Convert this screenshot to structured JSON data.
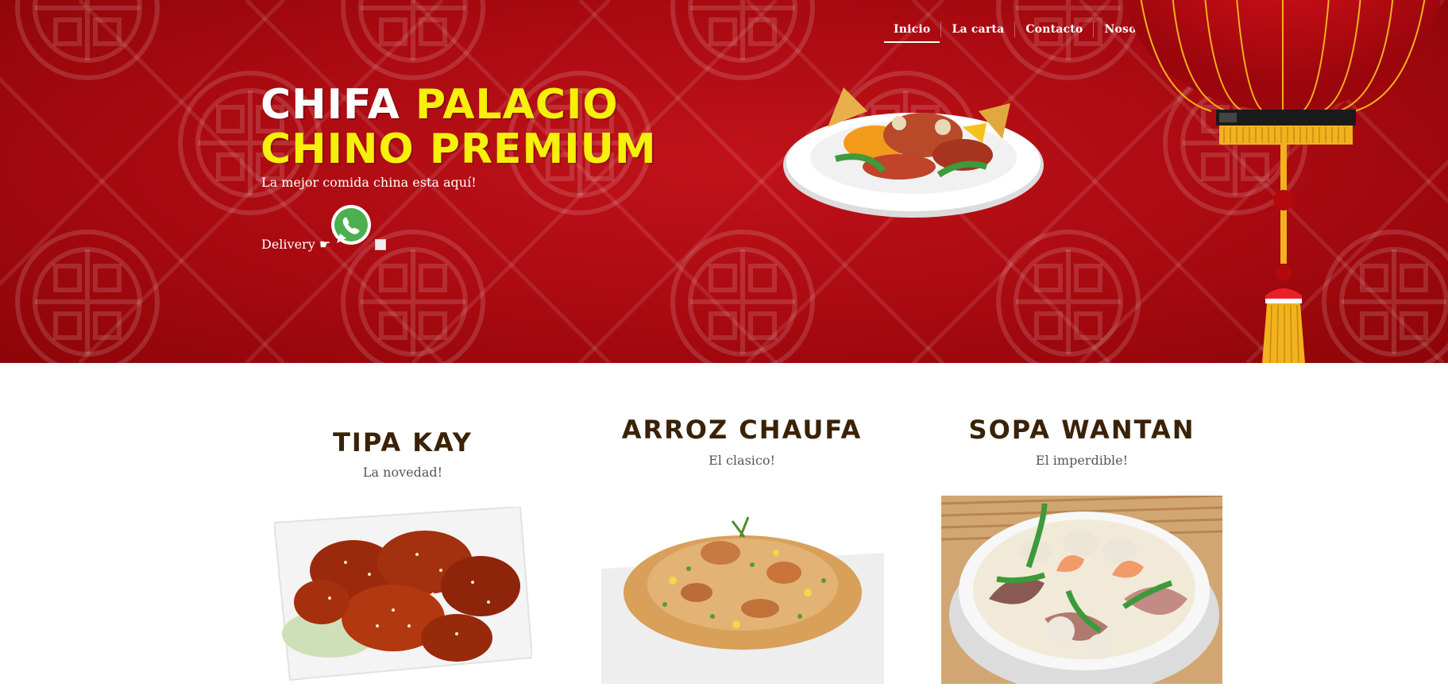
{
  "nav": {
    "items": [
      {
        "label": "Inicio",
        "active": true
      },
      {
        "label": "La carta",
        "active": false
      },
      {
        "label": "Contacto",
        "active": false
      },
      {
        "label": "Nosotros",
        "active": false
      }
    ],
    "social_icon": "facebook-icon"
  },
  "hero": {
    "title_part1": "CHIFA ",
    "title_part2": "PALACIO",
    "title_line2": "CHINO PREMIUM",
    "subtitle": "La mejor comida china esta aquí!",
    "delivery_label": "Delivery ☛",
    "delivery_icon": "whatsapp-icon",
    "colors": {
      "accent": "#f6f00a",
      "background": "#a80a10",
      "text": "#ffffff"
    }
  },
  "dishes": [
    {
      "title": "TIPA KAY",
      "subtitle": "La novedad!"
    },
    {
      "title": "ARROZ CHAUFA",
      "subtitle": "El clasico!"
    },
    {
      "title": "SOPA WANTAN",
      "subtitle": "El imperdible!"
    }
  ]
}
